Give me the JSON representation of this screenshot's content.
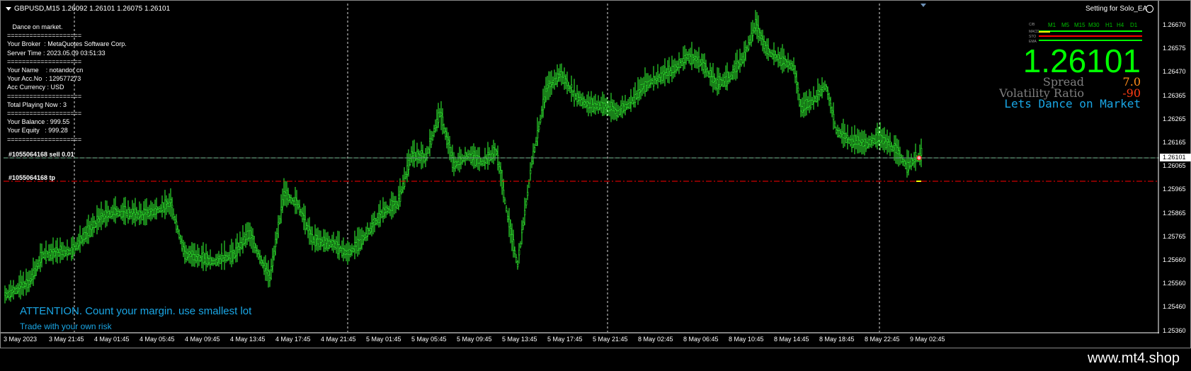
{
  "header": {
    "symbol_line": "GBPUSD,M15  1.26092 1.26101 1.26075 1.26101"
  },
  "info_panel": {
    "lines": [
      "   Dance on market.",
      "====================",
      "Your Broker  : MetaQuotes Software Corp.",
      "Server Time : 2023.05.09 03:51:33",
      "====================",
      "Your Name    : notandor cn",
      "Your Acc.No  : 129577273",
      "Acc Currency : USD",
      "====================",
      "Total Playing Now : 3",
      "====================",
      "Your Balance : 999.55",
      "Your Equity   : 999.28",
      "===================="
    ]
  },
  "orders": {
    "sell_label": "#1055064168 sell 0.01",
    "tp_label": "#1055064168 tp"
  },
  "ea_panel": {
    "setting_title": "Setting for Solo_EA",
    "big_price": "1.26101",
    "spread_label": "Spread",
    "spread_value": "7.0",
    "volatility_label": "Volatility Ratio",
    "volatility_value": "-90",
    "slogan": "Lets Dance on Market",
    "timeframes": [
      "M1",
      "M5",
      "M15",
      "M30",
      "H1",
      "H4",
      "D1"
    ],
    "indicator_labels": [
      "MACD",
      "STO",
      "EMA"
    ],
    "corner_label": "C/B",
    "colors": {
      "price": "#00ff00",
      "spread": "#ff8c1a",
      "volatility": "#ff3c14",
      "slogan": "#1aa7e6"
    }
  },
  "warnings": {
    "attention": "ATTENTION. Count your margin. use smallest lot",
    "trade_risk": "Trade with your own risk"
  },
  "price_axis": {
    "ticks": [
      "1.26670",
      "1.26575",
      "1.26470",
      "1.26365",
      "1.26265",
      "1.26165",
      "1.26065",
      "1.25965",
      "1.25865",
      "1.25765",
      "1.25660",
      "1.25560",
      "1.25460",
      "1.25360"
    ],
    "current_price": "1.26101"
  },
  "time_axis": {
    "ticks": [
      "3 May 2023",
      "3 May 21:45",
      "4 May 01:45",
      "4 May 05:45",
      "4 May 09:45",
      "4 May 13:45",
      "4 May 17:45",
      "4 May 21:45",
      "5 May 01:45",
      "5 May 05:45",
      "5 May 09:45",
      "5 May 13:45",
      "5 May 17:45",
      "5 May 21:45",
      "8 May 02:45",
      "8 May 06:45",
      "8 May 10:45",
      "8 May 14:45",
      "8 May 18:45",
      "8 May 22:45",
      "9 May 02:45"
    ]
  },
  "watermark": "www.mt4.shop"
}
